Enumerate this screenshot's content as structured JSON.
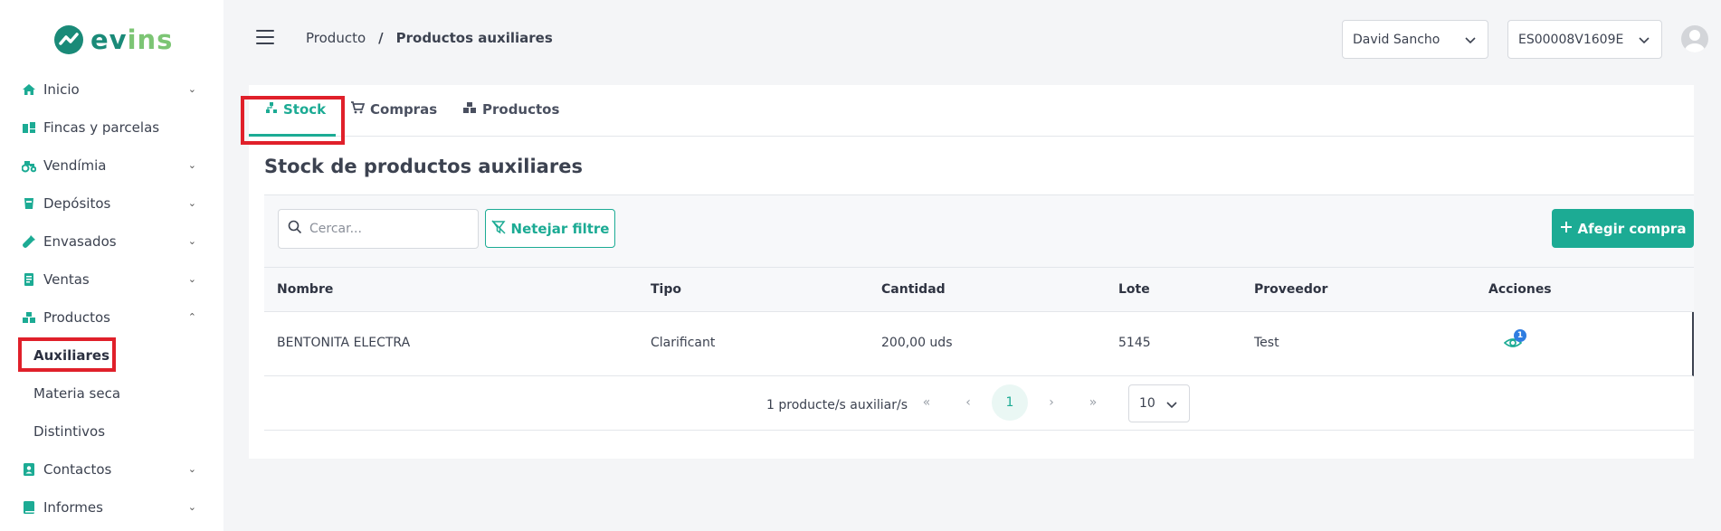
{
  "brand": {
    "name_part1": "ev",
    "name_part2": "ins",
    "primary_color": "#1a8a78",
    "accent_color": "#1cab94",
    "highlight_color": "#e0202a"
  },
  "sidebar": {
    "items": [
      {
        "label": "Inicio",
        "icon": "home-icon",
        "expandable": true
      },
      {
        "label": "Fincas y parcelas",
        "icon": "fields-icon",
        "expandable": false
      },
      {
        "label": "Vendímia",
        "icon": "tractor-icon",
        "expandable": true
      },
      {
        "label": "Depósitos",
        "icon": "tank-icon",
        "expandable": true
      },
      {
        "label": "Envasados",
        "icon": "bottle-icon",
        "expandable": true
      },
      {
        "label": "Ventas",
        "icon": "invoice-icon",
        "expandable": true
      },
      {
        "label": "Productos",
        "icon": "boxes-icon",
        "expandable": true,
        "expanded": true
      }
    ],
    "subitems": [
      {
        "label": "Auxiliares",
        "active": true
      },
      {
        "label": "Materia seca",
        "active": false
      },
      {
        "label": "Distintivos",
        "active": false
      }
    ],
    "items_after": [
      {
        "label": "Contactos",
        "icon": "contact-icon",
        "expandable": true
      },
      {
        "label": "Informes",
        "icon": "book-icon",
        "expandable": true
      }
    ]
  },
  "header": {
    "breadcrumb": {
      "parent": "Producto",
      "separator": "/",
      "current": "Productos auxiliares"
    },
    "user_select": "David Sancho",
    "company_select": "ES00008V1609E"
  },
  "tabs": [
    {
      "label": "Stock",
      "icon": "sitemap-icon",
      "active": true
    },
    {
      "label": "Compras",
      "icon": "cart-icon",
      "active": false
    },
    {
      "label": "Productos",
      "icon": "boxes-icon",
      "active": false
    }
  ],
  "main": {
    "title": "Stock de productos auxiliares",
    "search_placeholder": "Cercar...",
    "clear_filter_label": "Netejar filtre",
    "add_purchase_label": "Afegir compra"
  },
  "table": {
    "columns": [
      "Nombre",
      "Tipo",
      "Cantidad",
      "Lote",
      "Proveedor",
      "Acciones"
    ],
    "rows": [
      {
        "nombre": "BENTONITA ELECTRA",
        "tipo": "Clarificant",
        "cantidad": "200,00 uds",
        "lote": "5145",
        "proveedor": "Test",
        "badge": "1"
      }
    ]
  },
  "pagination": {
    "info": "1 producte/s auxiliar/s",
    "first": "«",
    "prev": "‹",
    "current_page": "1",
    "next": "›",
    "last": "»",
    "page_size": "10"
  }
}
